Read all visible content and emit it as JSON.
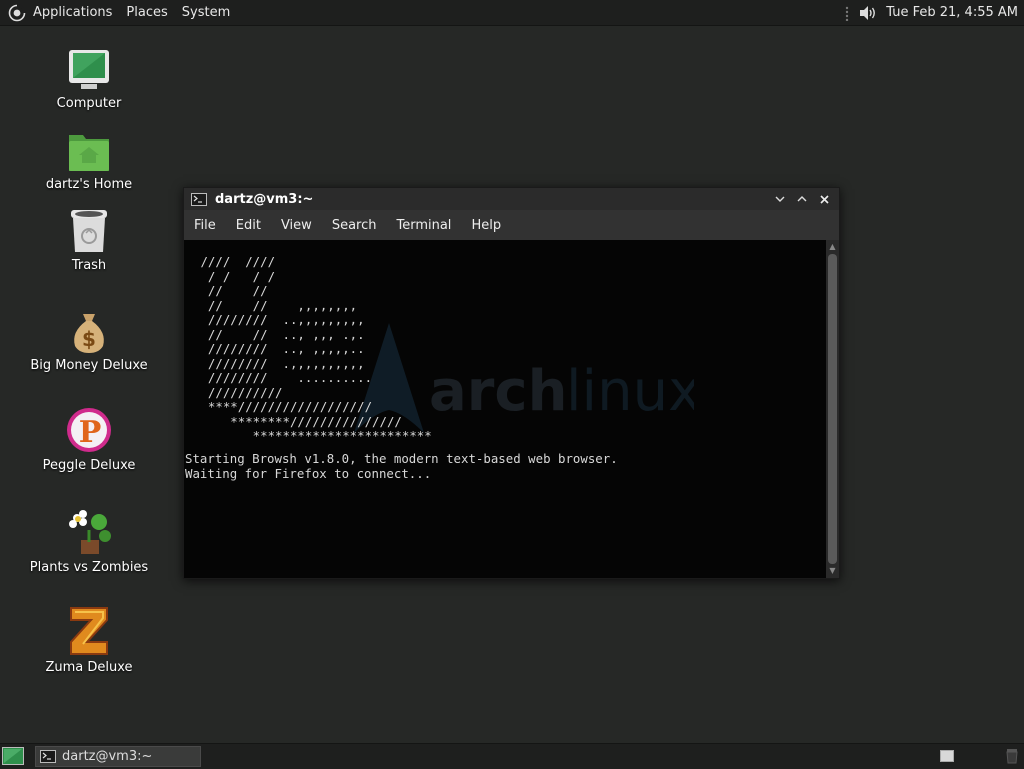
{
  "top_panel": {
    "menus": [
      "Applications",
      "Places",
      "System"
    ],
    "clock": "Tue Feb 21,  4:55 AM",
    "icons": [
      "applications-logo-icon",
      "handle-icon",
      "volume-icon"
    ]
  },
  "desktop": {
    "icons": [
      {
        "label": "Computer",
        "icon": "computer-icon"
      },
      {
        "label": "dartz's Home",
        "icon": "home-folder-icon"
      },
      {
        "label": "Trash",
        "icon": "trash-icon"
      },
      {
        "label": "Big Money Deluxe",
        "icon": "money-bag-icon"
      },
      {
        "label": "Peggle Deluxe",
        "icon": "peggle-icon"
      },
      {
        "label": "Plants vs Zombies",
        "icon": "plants-icon"
      },
      {
        "label": "Zuma Deluxe",
        "icon": "zuma-icon"
      }
    ]
  },
  "terminal": {
    "title": "dartz@vm3:~",
    "menus": [
      "File",
      "Edit",
      "View",
      "Search",
      "Terminal",
      "Help"
    ],
    "watermark": {
      "bold": "arch",
      "light": "linux"
    },
    "ascii_lines": [
      " ////  ////",
      "  / /   / /",
      "  //    //",
      "  //    //    ,,,,,,,,",
      "  ////////  ..,,,,,,,,,",
      "  //    //  .., ,,, .,.",
      "  ////////  .., ,,,,,..",
      "  ////////  .,,,,,,,,,,",
      "  ////////    ..........",
      "  //////////",
      "  ****//////////////////",
      "     ********///////////////",
      "        ************************"
    ],
    "output_lines": [
      "Starting Browsh v1.8.0, the modern text-based web browser.",
      "Waiting for Firefox to connect..."
    ]
  },
  "taskbar": {
    "task_label": "dartz@vm3:~"
  }
}
